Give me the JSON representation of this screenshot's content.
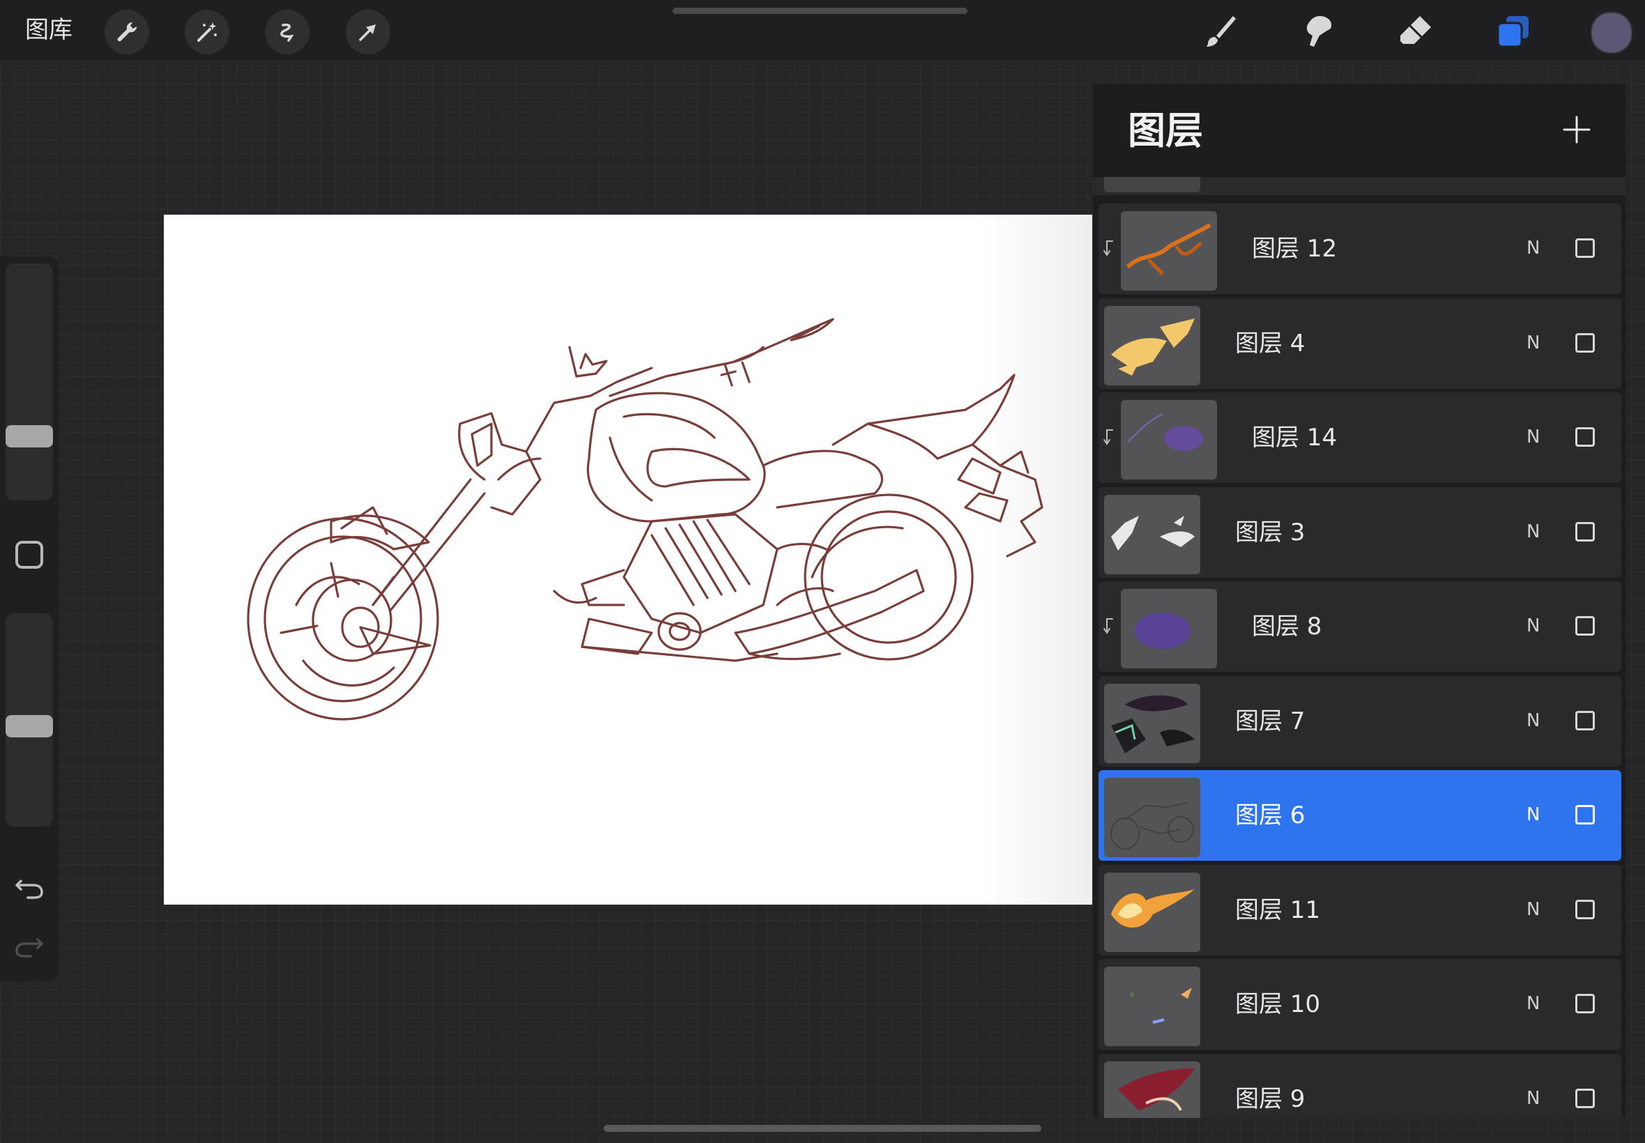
{
  "topbar": {
    "gallery_label": "图库",
    "left_tools": [
      {
        "icon": "wrench-icon",
        "name": "actions"
      },
      {
        "icon": "magic-wand-icon",
        "name": "adjustments"
      },
      {
        "icon": "selection-icon",
        "name": "selection"
      },
      {
        "icon": "transform-arrow-icon",
        "name": "transform"
      }
    ],
    "right_tools": [
      {
        "icon": "brush-icon",
        "name": "paint"
      },
      {
        "icon": "smudge-icon",
        "name": "smudge"
      },
      {
        "icon": "eraser-icon",
        "name": "erase"
      },
      {
        "icon": "layers-icon",
        "name": "layers",
        "active": true
      }
    ],
    "color": "#5b5876"
  },
  "sidebar": {
    "brush_size_level": 0.7,
    "opacity_level": 0.45,
    "undo_icon": "undo-icon",
    "redo_icon": "redo-icon"
  },
  "layers_panel": {
    "title": "图层",
    "add_icon": "plus-icon",
    "layers": [
      {
        "name": "图层 12",
        "blend": "N",
        "clipped": true,
        "selected": false,
        "thumb": "orange-strokes"
      },
      {
        "name": "图层 4",
        "blend": "N",
        "clipped": false,
        "selected": false,
        "thumb": "yellow-shapes"
      },
      {
        "name": "图层 14",
        "blend": "N",
        "clipped": true,
        "selected": false,
        "thumb": "purple-strokes"
      },
      {
        "name": "图层 3",
        "blend": "N",
        "clipped": false,
        "selected": false,
        "thumb": "white-shapes"
      },
      {
        "name": "图层 8",
        "blend": "N",
        "clipped": true,
        "selected": false,
        "thumb": "purple-blur"
      },
      {
        "name": "图层 7",
        "blend": "N",
        "clipped": false,
        "selected": false,
        "thumb": "dark-shapes"
      },
      {
        "name": "图层 6",
        "blend": "N",
        "clipped": false,
        "selected": true,
        "thumb": "line-art"
      },
      {
        "name": "图层 11",
        "blend": "N",
        "clipped": false,
        "selected": false,
        "thumb": "fire"
      },
      {
        "name": "图层 10",
        "blend": "N",
        "clipped": false,
        "selected": false,
        "thumb": "small-marks"
      },
      {
        "name": "图层 9",
        "blend": "N",
        "clipped": false,
        "selected": false,
        "thumb": "purple-red"
      }
    ]
  },
  "colors": {
    "accent": "#2f74ef",
    "line_art": "#7a3e3a"
  }
}
